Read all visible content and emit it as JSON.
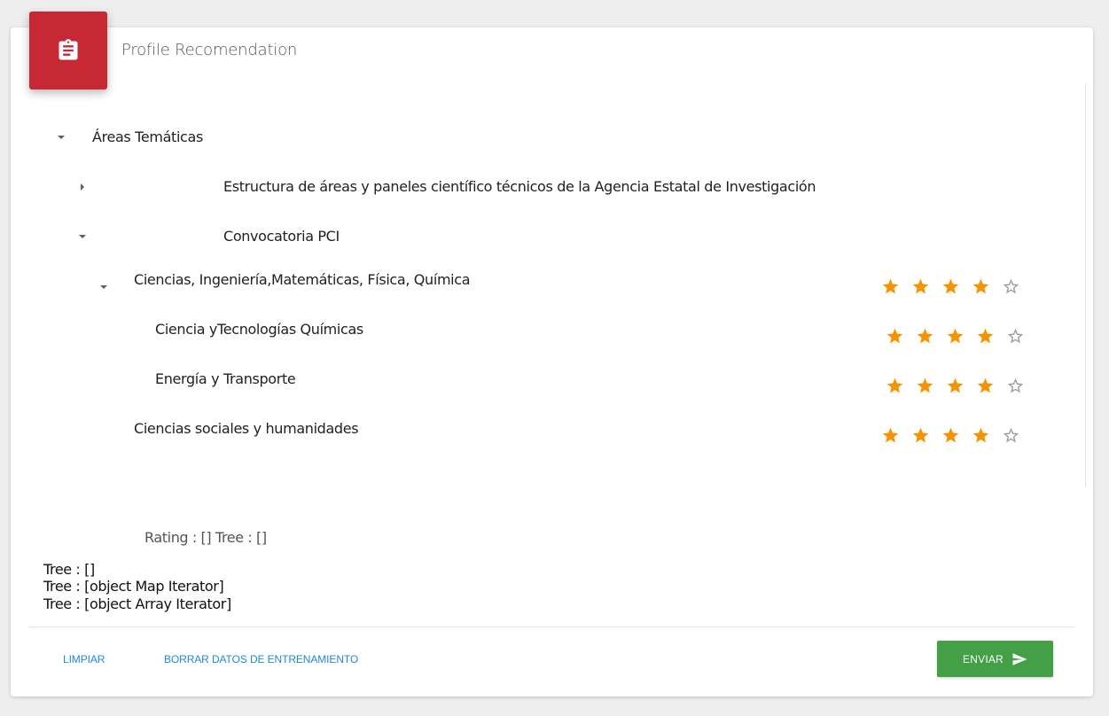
{
  "header": {
    "title": "Profile Recomendation",
    "icon": "clipboard-icon",
    "icon_color": "#c62834"
  },
  "tree": {
    "root": {
      "label": "Áreas Temáticas",
      "expanded": true
    },
    "aei": {
      "label": "Estructura de áreas y paneles científico técnicos de la Agencia Estatal de Investigación",
      "expanded": false
    },
    "pci": {
      "label": "Convocatoria PCI",
      "expanded": true
    },
    "ciencias_ing": {
      "label": "Ciencias, Ingeniería,Matemáticas, Física, Química",
      "expanded": true,
      "rating": 4,
      "max_rating": 5
    },
    "quimicas": {
      "label": "Ciencia yTecnologías Químicas",
      "rating": 4,
      "max_rating": 5
    },
    "energia": {
      "label": "Energía y Transporte",
      "rating": 4,
      "max_rating": 5
    },
    "sociales": {
      "label": "Ciencias sociales y humanidades",
      "rating": 4,
      "max_rating": 5
    }
  },
  "debug": {
    "rating_tree": "Rating : [] Tree : []",
    "lines": [
      "Tree : []",
      "Tree : [object Map Iterator]",
      "Tree : [object Array Iterator]"
    ]
  },
  "actions": {
    "clear": "LIMPIAR",
    "delete_training": "BORRAR DATOS DE ENTRENAMIENTO",
    "send": "ENVIAR",
    "send_icon": "send-icon"
  },
  "colors": {
    "star": "#f59300",
    "star_empty": "#9e9e9e",
    "send_button": "#43a047",
    "link": "#1e88e5"
  }
}
